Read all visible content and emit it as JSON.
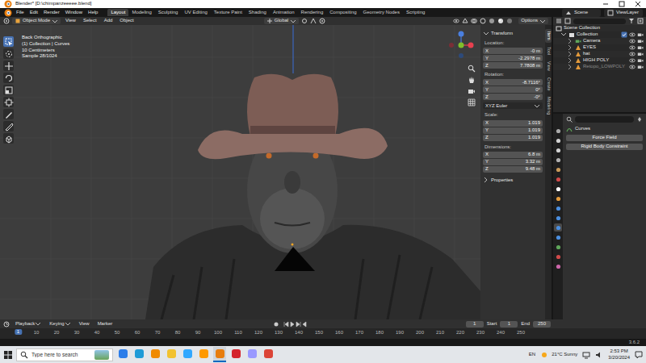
{
  "window": {
    "title": "Blender* [D:\\chimpanzeeeee.blend]"
  },
  "menus": [
    "File",
    "Edit",
    "Render",
    "Window",
    "Help"
  ],
  "workspaces": [
    {
      "label": "Layout",
      "selected": true
    },
    {
      "label": "Modeling",
      "selected": false
    },
    {
      "label": "Sculpting",
      "selected": false
    },
    {
      "label": "UV Editing",
      "selected": false
    },
    {
      "label": "Texture Paint",
      "selected": false
    },
    {
      "label": "Shading",
      "selected": false
    },
    {
      "label": "Animation",
      "selected": false
    },
    {
      "label": "Rendering",
      "selected": false
    },
    {
      "label": "Compositing",
      "selected": false
    },
    {
      "label": "Geometry Nodes",
      "selected": false
    },
    {
      "label": "Scripting",
      "selected": false
    }
  ],
  "scene": "Scene",
  "view_layer": "ViewLayer",
  "viewport_header": {
    "mode": "Object Mode",
    "menus": [
      "View",
      "Select",
      "Add",
      "Object"
    ],
    "orientation": "Global",
    "options": "Options"
  },
  "overlay_text": [
    "Back Orthographic",
    "(1) Collection | Curves",
    "10 Centimeters",
    "Sample 28/1024"
  ],
  "tools": [
    {
      "selected": true
    },
    {
      "selected": false
    },
    {
      "selected": false
    },
    {
      "selected": false
    },
    {
      "selected": false
    },
    {
      "selected": false
    },
    {
      "selected": false
    },
    {
      "selected": false
    },
    {
      "selected": false
    }
  ],
  "sidebar": {
    "title": "Transform",
    "groups": [
      {
        "label": "Location:",
        "fields": [
          {
            "axis": "X",
            "value": "-0 m"
          },
          {
            "axis": "Y",
            "value": "-2.2978 m"
          },
          {
            "axis": "Z",
            "value": "7.7808 m"
          }
        ]
      },
      {
        "label": "Rotation:",
        "fields": [
          {
            "axis": "X",
            "value": "-8.7116°"
          },
          {
            "axis": "Y",
            "value": "0°"
          },
          {
            "axis": "Z",
            "value": "-0°"
          }
        ],
        "mode": "XYZ Euler"
      },
      {
        "label": "Scale:",
        "fields": [
          {
            "axis": "X",
            "value": "1.019"
          },
          {
            "axis": "Y",
            "value": "1.019"
          },
          {
            "axis": "Z",
            "value": "1.019"
          }
        ]
      },
      {
        "label": "Dimensions:",
        "fields": [
          {
            "axis": "X",
            "value": "6.8 m"
          },
          {
            "axis": "Y",
            "value": "3.32 m"
          },
          {
            "axis": "Z",
            "value": "9.48 m"
          }
        ]
      }
    ],
    "properties": "Properties",
    "tabs": [
      {
        "label": "Item",
        "selected": true
      },
      {
        "label": "Tool",
        "selected": false
      },
      {
        "label": "View",
        "selected": false
      },
      {
        "label": "Create",
        "selected": false
      },
      {
        "label": "Modeling",
        "selected": false
      }
    ]
  },
  "outliner": {
    "title": "Scene Collection",
    "items": [
      {
        "label": "Collection",
        "kind": "collection",
        "disabled": false
      },
      {
        "label": "Camera",
        "kind": "camera",
        "disabled": false
      },
      {
        "label": "EYES",
        "kind": "mesh",
        "disabled": false
      },
      {
        "label": "hat",
        "kind": "mesh",
        "disabled": false
      },
      {
        "label": "HIGH POLY",
        "kind": "mesh",
        "disabled": false
      },
      {
        "label": "Retopo_LOWPOLY",
        "kind": "mesh",
        "disabled": true
      }
    ]
  },
  "properties_editor": {
    "context": "Curves",
    "buttons": [
      "Force Field",
      "Rigid Body Constraint"
    ],
    "tabs": [
      {
        "kind": "tool",
        "selected": false
      },
      {
        "kind": "render",
        "selected": false
      },
      {
        "kind": "output",
        "selected": false
      },
      {
        "kind": "view",
        "selected": false
      },
      {
        "kind": "scene",
        "selected": false
      },
      {
        "kind": "world",
        "selected": false
      },
      {
        "kind": "collection",
        "selected": false
      },
      {
        "kind": "object",
        "selected": false
      },
      {
        "kind": "modifiers",
        "selected": false
      },
      {
        "kind": "particles",
        "selected": false
      },
      {
        "kind": "physics",
        "selected": true
      },
      {
        "kind": "constraints",
        "selected": false
      },
      {
        "kind": "data",
        "selected": false
      },
      {
        "kind": "material",
        "selected": false
      },
      {
        "kind": "texture",
        "selected": false
      }
    ]
  },
  "timeline": {
    "menus": [
      "Playback",
      "Keying",
      "View",
      "Marker"
    ],
    "frame": "1",
    "start_label": "Start",
    "start": "1",
    "end_label": "End",
    "end": "250",
    "current": "1",
    "ticks": [
      "10",
      "20",
      "30",
      "40",
      "50",
      "60",
      "70",
      "80",
      "90",
      "100",
      "110",
      "120",
      "130",
      "140",
      "150",
      "160",
      "170",
      "180",
      "190",
      "200",
      "210",
      "220",
      "230",
      "240",
      "250"
    ]
  },
  "status_bar": {
    "version": "3.6.2"
  },
  "taskbar": {
    "search": "Type here to search",
    "language": "EN",
    "weather": "21°C Sunny",
    "time": "2:53 PM",
    "date": "3/20/2024",
    "apps": [
      {
        "color": "#2b7de9",
        "selected": false
      },
      {
        "color": "#1e9bd7",
        "selected": false
      },
      {
        "color": "#f08a00",
        "selected": false
      },
      {
        "color": "#f2c230",
        "selected": false
      },
      {
        "color": "#31a8ff",
        "selected": false
      },
      {
        "color": "#ff9a00",
        "selected": false
      },
      {
        "color": "#e87d0d",
        "selected": true
      },
      {
        "color": "#d4232c",
        "selected": false
      },
      {
        "color": "#9999ff",
        "selected": false
      },
      {
        "color": "#db4437",
        "selected": false
      }
    ]
  }
}
